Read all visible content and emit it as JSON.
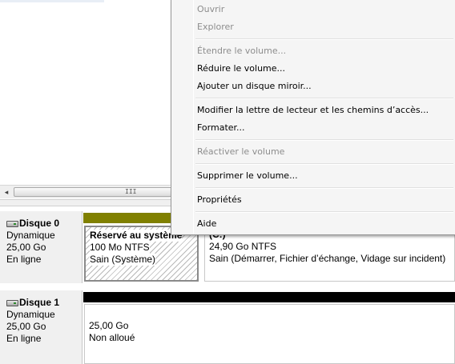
{
  "context_menu": {
    "items": [
      {
        "label": "Ouvrir",
        "enabled": false
      },
      {
        "label": "Explorer",
        "enabled": false
      },
      {
        "label": "Étendre le volume...",
        "enabled": false
      },
      {
        "label": "Réduire le volume...",
        "enabled": true
      },
      {
        "label": "Ajouter un disque miroir...",
        "enabled": true
      },
      {
        "label": "Modifier la lettre de lecteur et les chemins d’accès...",
        "enabled": true
      },
      {
        "label": "Formater...",
        "enabled": true
      },
      {
        "label": "Réactiver le volume",
        "enabled": false
      },
      {
        "label": "Supprimer le volume...",
        "enabled": true
      },
      {
        "label": "Propriétés",
        "enabled": true
      },
      {
        "label": "Aide",
        "enabled": true
      }
    ]
  },
  "scrollbar": {
    "left_arrow": "◂",
    "grip": "III"
  },
  "disks": [
    {
      "name": "Disque 0",
      "type": "Dynamique",
      "size": "25,00 Go",
      "status": "En ligne",
      "bar_color": "#808000",
      "volumes": [
        {
          "name": "Réservé au système",
          "size_fs": "100 Mo NTFS",
          "status": "Sain (Système)"
        },
        {
          "name": "(C:)",
          "size_fs": "24,90 Go NTFS",
          "status": "Sain (Démarrer, Fichier d’échange, Vidage sur incident)"
        }
      ]
    },
    {
      "name": "Disque 1",
      "type": "Dynamique",
      "size": "25,00 Go",
      "status": "En ligne",
      "bar_color": "#000000",
      "volumes": [
        {
          "name": "",
          "size_fs": "25,00 Go",
          "status": "Non alloué"
        }
      ]
    }
  ]
}
